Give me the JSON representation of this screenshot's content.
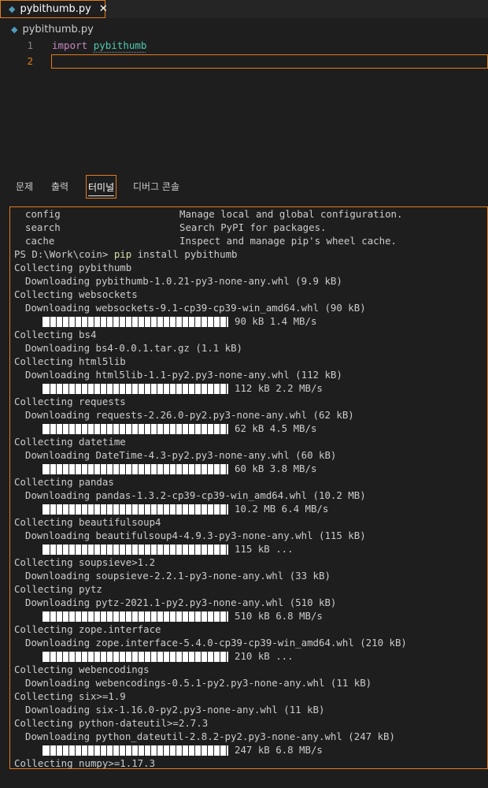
{
  "tab": {
    "filename": "pybithumb.py",
    "close": "✕",
    "icon": "python-file-icon"
  },
  "breadcrumb": {
    "filename": "pybithumb.py"
  },
  "editor": {
    "lines": [
      {
        "number": "1",
        "keyword": "import",
        "module": "pybithumb"
      },
      {
        "number": "2"
      }
    ]
  },
  "panel": {
    "tabs": [
      "문제",
      "출력",
      "터미널",
      "디버그 콘솔"
    ],
    "active": "터미널"
  },
  "terminal": {
    "lines": [
      {
        "kind": "cmdhelp",
        "a": "config",
        "b": "Manage local and global configuration."
      },
      {
        "kind": "cmdhelp",
        "a": "search",
        "b": "Search PyPI for packages."
      },
      {
        "kind": "cmdhelp",
        "a": "cache",
        "b": "Inspect and manage pip's wheel cache."
      },
      {
        "kind": "prompt",
        "prompt": "PS D:\\Work\\coin> ",
        "cmd": "pip",
        "rest": " install pybithumb"
      },
      {
        "kind": "text",
        "text": "Collecting pybithumb"
      },
      {
        "kind": "indent",
        "text": "Downloading pybithumb-1.0.21-py3-none-any.whl (9.9 kB)"
      },
      {
        "kind": "text",
        "text": "Collecting websockets"
      },
      {
        "kind": "indent",
        "text": "Downloading websockets-9.1-cp39-cp39-win_amd64.whl (90 kB)"
      },
      {
        "kind": "bar",
        "text": "90 kB 1.4 MB/s",
        "progress": 1.0
      },
      {
        "kind": "text",
        "text": "Collecting bs4"
      },
      {
        "kind": "indent",
        "text": "Downloading bs4-0.0.1.tar.gz (1.1 kB)"
      },
      {
        "kind": "text",
        "text": "Collecting html5lib"
      },
      {
        "kind": "indent",
        "text": "Downloading html5lib-1.1-py2.py3-none-any.whl (112 kB)"
      },
      {
        "kind": "bar",
        "text": "112 kB 2.2 MB/s",
        "progress": 1.0
      },
      {
        "kind": "text",
        "text": "Collecting requests"
      },
      {
        "kind": "indent",
        "text": "Downloading requests-2.26.0-py2.py3-none-any.whl (62 kB)"
      },
      {
        "kind": "bar",
        "text": "62 kB 4.5 MB/s",
        "progress": 1.0
      },
      {
        "kind": "text",
        "text": "Collecting datetime"
      },
      {
        "kind": "indent",
        "text": "Downloading DateTime-4.3-py2.py3-none-any.whl (60 kB)"
      },
      {
        "kind": "bar",
        "text": "60 kB 3.8 MB/s",
        "progress": 1.0
      },
      {
        "kind": "text",
        "text": "Collecting pandas"
      },
      {
        "kind": "indent",
        "text": "Downloading pandas-1.3.2-cp39-cp39-win_amd64.whl (10.2 MB)"
      },
      {
        "kind": "bar",
        "text": "10.2 MB 6.4 MB/s",
        "progress": 1.0
      },
      {
        "kind": "text",
        "text": "Collecting beautifulsoup4"
      },
      {
        "kind": "indent",
        "text": "Downloading beautifulsoup4-4.9.3-py3-none-any.whl (115 kB)"
      },
      {
        "kind": "bar",
        "text": "115 kB ...",
        "progress": 1.0
      },
      {
        "kind": "text",
        "text": "Collecting soupsieve>1.2"
      },
      {
        "kind": "indent",
        "text": "Downloading soupsieve-2.2.1-py3-none-any.whl (33 kB)"
      },
      {
        "kind": "text",
        "text": "Collecting pytz"
      },
      {
        "kind": "indent",
        "text": "Downloading pytz-2021.1-py2.py3-none-any.whl (510 kB)"
      },
      {
        "kind": "bar",
        "text": "510 kB 6.8 MB/s",
        "progress": 1.0
      },
      {
        "kind": "text",
        "text": "Collecting zope.interface"
      },
      {
        "kind": "indent",
        "text": "Downloading zope.interface-5.4.0-cp39-cp39-win_amd64.whl (210 kB)"
      },
      {
        "kind": "bar",
        "text": "210 kB ...",
        "progress": 1.0
      },
      {
        "kind": "text",
        "text": "Collecting webencodings"
      },
      {
        "kind": "indent",
        "text": "Downloading webencodings-0.5.1-py2.py3-none-any.whl (11 kB)"
      },
      {
        "kind": "text",
        "text": "Collecting six>=1.9"
      },
      {
        "kind": "indent",
        "text": "Downloading six-1.16.0-py2.py3-none-any.whl (11 kB)"
      },
      {
        "kind": "text",
        "text": "Collecting python-dateutil>=2.7.3"
      },
      {
        "kind": "indent",
        "text": "Downloading python_dateutil-2.8.2-py2.py3-none-any.whl (247 kB)"
      },
      {
        "kind": "bar",
        "text": "247 kB 6.8 MB/s",
        "progress": 1.0
      },
      {
        "kind": "text",
        "text": "Collecting numpy>=1.17.3"
      }
    ]
  },
  "colors": {
    "accent": "#e27d1a",
    "keyword": "#c586c0",
    "module": "#4ec9b0",
    "command": "#dcdcaa"
  }
}
